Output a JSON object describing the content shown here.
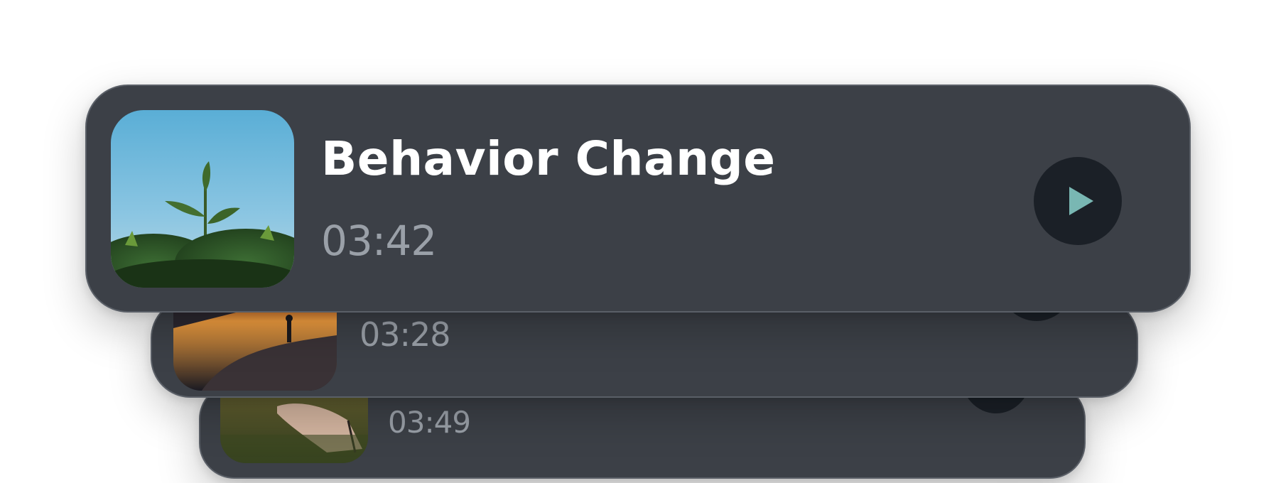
{
  "tracks": [
    {
      "title": "Behavior Change",
      "duration": "03:42",
      "thumbnail_icon": "plant-sprout-image",
      "play_icon": "play-icon",
      "accent_color": "#79b7b3"
    },
    {
      "title": "",
      "duration": "03:28",
      "thumbnail_icon": "sunset-lake-image",
      "play_icon": "play-icon"
    },
    {
      "title": "",
      "duration": "03:49",
      "thumbnail_icon": "hand-meadow-image",
      "play_icon": "play-icon"
    }
  ],
  "colors": {
    "card_background": "#3c4047",
    "card_border": "#5a5f67",
    "play_button_background": "#1b2027",
    "title_text": "#ffffff",
    "duration_text": "#9aa0a8"
  }
}
